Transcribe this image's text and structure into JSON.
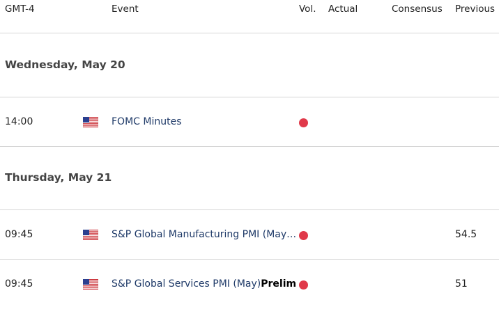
{
  "header": {
    "timezone": "GMT-4",
    "event": "Event",
    "vol": "Vol.",
    "actual": "Actual",
    "consensus": "Consensus",
    "previous": "Previous"
  },
  "colors": {
    "volatility_high": "#e0394a",
    "event_text": "#1f3a68"
  },
  "days": [
    {
      "title": "Wednesday, May 20",
      "events": [
        {
          "time": "14:00",
          "flag": "us-flag-icon",
          "event": "FOMC Minutes",
          "event_bold": "",
          "volatility": "high",
          "actual": "",
          "consensus": "",
          "previous": ""
        }
      ]
    },
    {
      "title": "Thursday, May 21",
      "events": [
        {
          "time": "09:45",
          "flag": "us-flag-icon",
          "event": "S&P Global Manufacturing PMI (May)Prelim",
          "event_bold": "",
          "volatility": "high",
          "actual": "",
          "consensus": "",
          "previous": "54.5"
        },
        {
          "time": "09:45",
          "flag": "us-flag-icon",
          "event": "S&P Global Services PMI (May)",
          "event_bold": "Prelim",
          "volatility": "high",
          "actual": "",
          "consensus": "",
          "previous": "51"
        }
      ]
    }
  ]
}
